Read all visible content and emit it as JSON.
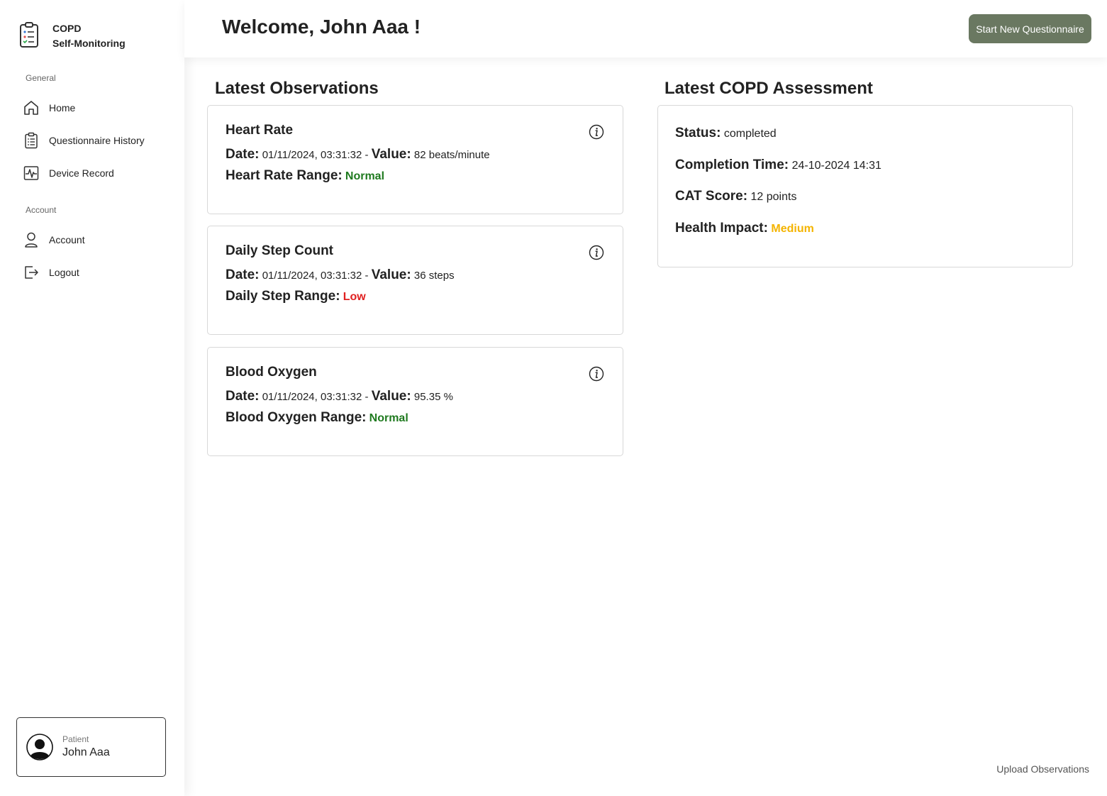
{
  "brand": {
    "line1": "COPD",
    "line2": "Self-Monitoring"
  },
  "sidebar": {
    "general_label": "General",
    "general_items": [
      {
        "label": "Home",
        "icon": "home-icon"
      },
      {
        "label": "Questionnaire History",
        "icon": "clipboard-list-icon"
      },
      {
        "label": "Device Record",
        "icon": "pulse-icon"
      }
    ],
    "account_label": "Account",
    "account_items": [
      {
        "label": "Account",
        "icon": "user-icon"
      },
      {
        "label": "Logout",
        "icon": "logout-icon"
      }
    ]
  },
  "user": {
    "role": "Patient",
    "name": "John Aaa"
  },
  "header": {
    "welcome": "Welcome, John Aaa !",
    "start_button": "Start New Questionnaire"
  },
  "observations": {
    "title": "Latest Observations",
    "items": [
      {
        "title": "Heart Rate",
        "date_label": "Date:",
        "date": "01/11/2024, 03:31:32 -",
        "value_label": "Value:",
        "value": "82 beats/minute",
        "range_label": "Heart Rate Range:",
        "range": "Normal",
        "range_color": "#1f7a1f"
      },
      {
        "title": "Daily Step Count",
        "date_label": "Date:",
        "date": "01/11/2024, 03:31:32 -",
        "value_label": "Value:",
        "value": "36 steps",
        "range_label": "Daily Step Range:",
        "range": "Low",
        "range_color": "#e02020"
      },
      {
        "title": "Blood Oxygen",
        "date_label": "Date:",
        "date": "01/11/2024, 03:31:32 -",
        "value_label": "Value:",
        "value": "95.35 %",
        "range_label": "Blood Oxygen Range:",
        "range": "Normal",
        "range_color": "#1f7a1f"
      }
    ]
  },
  "assessment": {
    "title": "Latest COPD Assessment",
    "status_label": "Status:",
    "status": "completed",
    "completion_label": "Completion Time:",
    "completion": "24-10-2024 14:31",
    "cat_label": "CAT Score:",
    "cat": "12 points",
    "impact_label": "Health Impact:",
    "impact": "Medium",
    "impact_color": "#f4b400"
  },
  "footer": {
    "upload_link": "Upload Observations"
  },
  "colors": {
    "accent_button": "#6a7861"
  }
}
